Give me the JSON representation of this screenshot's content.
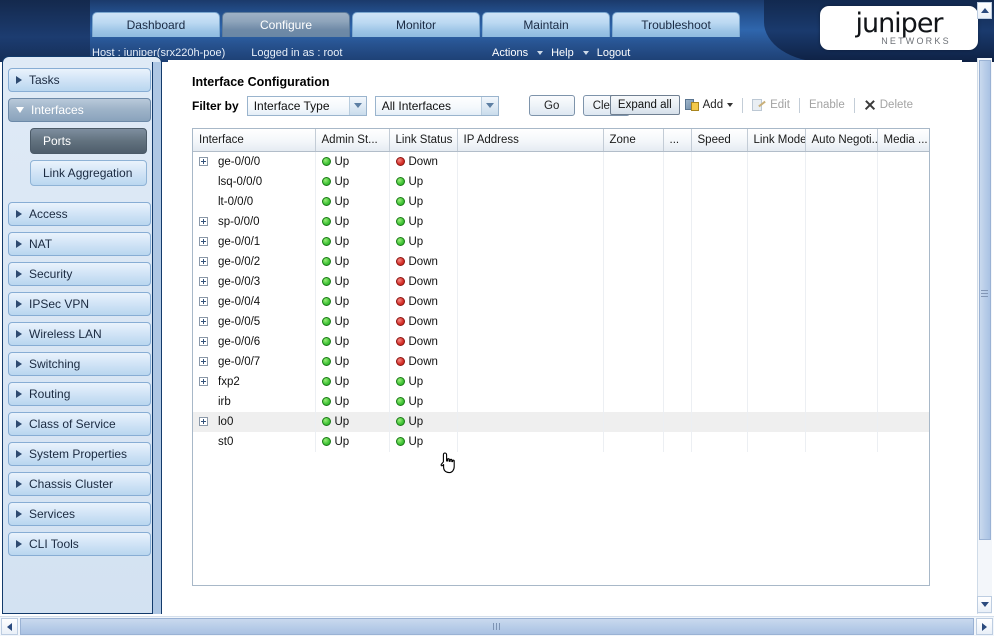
{
  "banner": {
    "tabs": [
      {
        "label": "Dashboard",
        "active": false
      },
      {
        "label": "Configure",
        "active": true
      },
      {
        "label": "Monitor",
        "active": false
      },
      {
        "label": "Maintain",
        "active": false
      },
      {
        "label": "Troubleshoot",
        "active": false
      }
    ],
    "host": "Host : juniper(srx220h-poe)",
    "logged_in": "Logged in as : root",
    "menus": [
      {
        "label": "Actions",
        "has_caret": true
      },
      {
        "label": "Help",
        "has_caret": true
      },
      {
        "label": "Logout",
        "has_caret": false
      }
    ],
    "logo": {
      "word": "juniper",
      "sub": "NETWORKS"
    }
  },
  "sidebar": {
    "items": [
      {
        "label": "Tasks",
        "state": "collapsed"
      },
      {
        "label": "Interfaces",
        "state": "expanded",
        "children": [
          {
            "label": "Ports",
            "selected": true
          },
          {
            "label": "Link Aggregation",
            "selected": false
          }
        ]
      },
      {
        "label": "Access",
        "state": "collapsed"
      },
      {
        "label": "NAT",
        "state": "collapsed"
      },
      {
        "label": "Security",
        "state": "collapsed"
      },
      {
        "label": "IPSec VPN",
        "state": "collapsed"
      },
      {
        "label": "Wireless LAN",
        "state": "collapsed"
      },
      {
        "label": "Switching",
        "state": "collapsed"
      },
      {
        "label": "Routing",
        "state": "collapsed"
      },
      {
        "label": "Class of Service",
        "state": "collapsed"
      },
      {
        "label": "System Properties",
        "state": "collapsed"
      },
      {
        "label": "Chassis Cluster",
        "state": "collapsed"
      },
      {
        "label": "Services",
        "state": "collapsed"
      },
      {
        "label": "CLI Tools",
        "state": "collapsed"
      }
    ]
  },
  "main": {
    "title": "Interface Configuration",
    "filter_label": "Filter by",
    "filter_type_value": "Interface Type",
    "filter_scope_value": "All Interfaces",
    "go_label": "Go",
    "clear_label": "Clear",
    "toolbar": {
      "expand_all": "Expand all",
      "add": "Add",
      "edit": "Edit",
      "enable": "Enable",
      "delete": "Delete"
    },
    "table": {
      "columns": [
        "Interface",
        "Admin St...",
        "Link Status",
        "IP Address",
        "Zone",
        "...",
        "Speed",
        "Link Mode",
        "Auto Negoti...",
        "Media ..."
      ],
      "rows": [
        {
          "expandable": true,
          "interface": "ge-0/0/0",
          "admin": "Up",
          "admin_state": "up",
          "link": "Down",
          "link_state": "down",
          "ip": "",
          "zone": "",
          "extra": "",
          "speed": "",
          "link_mode": "",
          "auto_neg": "",
          "media": "",
          "hover": false
        },
        {
          "expandable": false,
          "interface": "lsq-0/0/0",
          "admin": "Up",
          "admin_state": "up",
          "link": "Up",
          "link_state": "up",
          "ip": "",
          "zone": "",
          "extra": "",
          "speed": "",
          "link_mode": "",
          "auto_neg": "",
          "media": "",
          "hover": false
        },
        {
          "expandable": false,
          "interface": "lt-0/0/0",
          "admin": "Up",
          "admin_state": "up",
          "link": "Up",
          "link_state": "up",
          "ip": "",
          "zone": "",
          "extra": "",
          "speed": "",
          "link_mode": "",
          "auto_neg": "",
          "media": "",
          "hover": false
        },
        {
          "expandable": true,
          "interface": "sp-0/0/0",
          "admin": "Up",
          "admin_state": "up",
          "link": "Up",
          "link_state": "up",
          "ip": "",
          "zone": "",
          "extra": "",
          "speed": "",
          "link_mode": "",
          "auto_neg": "",
          "media": "",
          "hover": false
        },
        {
          "expandable": true,
          "interface": "ge-0/0/1",
          "admin": "Up",
          "admin_state": "up",
          "link": "Up",
          "link_state": "up",
          "ip": "",
          "zone": "",
          "extra": "",
          "speed": "",
          "link_mode": "",
          "auto_neg": "",
          "media": "",
          "hover": false
        },
        {
          "expandable": true,
          "interface": "ge-0/0/2",
          "admin": "Up",
          "admin_state": "up",
          "link": "Down",
          "link_state": "down",
          "ip": "",
          "zone": "",
          "extra": "",
          "speed": "",
          "link_mode": "",
          "auto_neg": "",
          "media": "",
          "hover": false
        },
        {
          "expandable": true,
          "interface": "ge-0/0/3",
          "admin": "Up",
          "admin_state": "up",
          "link": "Down",
          "link_state": "down",
          "ip": "",
          "zone": "",
          "extra": "",
          "speed": "",
          "link_mode": "",
          "auto_neg": "",
          "media": "",
          "hover": false
        },
        {
          "expandable": true,
          "interface": "ge-0/0/4",
          "admin": "Up",
          "admin_state": "up",
          "link": "Down",
          "link_state": "down",
          "ip": "",
          "zone": "",
          "extra": "",
          "speed": "",
          "link_mode": "",
          "auto_neg": "",
          "media": "",
          "hover": false
        },
        {
          "expandable": true,
          "interface": "ge-0/0/5",
          "admin": "Up",
          "admin_state": "up",
          "link": "Down",
          "link_state": "down",
          "ip": "",
          "zone": "",
          "extra": "",
          "speed": "",
          "link_mode": "",
          "auto_neg": "",
          "media": "",
          "hover": false
        },
        {
          "expandable": true,
          "interface": "ge-0/0/6",
          "admin": "Up",
          "admin_state": "up",
          "link": "Down",
          "link_state": "down",
          "ip": "",
          "zone": "",
          "extra": "",
          "speed": "",
          "link_mode": "",
          "auto_neg": "",
          "media": "",
          "hover": false
        },
        {
          "expandable": true,
          "interface": "ge-0/0/7",
          "admin": "Up",
          "admin_state": "up",
          "link": "Down",
          "link_state": "down",
          "ip": "",
          "zone": "",
          "extra": "",
          "speed": "",
          "link_mode": "",
          "auto_neg": "",
          "media": "",
          "hover": false
        },
        {
          "expandable": true,
          "interface": "fxp2",
          "admin": "Up",
          "admin_state": "up",
          "link": "Up",
          "link_state": "up",
          "ip": "",
          "zone": "",
          "extra": "",
          "speed": "",
          "link_mode": "",
          "auto_neg": "",
          "media": "",
          "hover": false
        },
        {
          "expandable": false,
          "interface": "irb",
          "admin": "Up",
          "admin_state": "up",
          "link": "Up",
          "link_state": "up",
          "ip": "",
          "zone": "",
          "extra": "",
          "speed": "",
          "link_mode": "",
          "auto_neg": "",
          "media": "",
          "hover": false
        },
        {
          "expandable": true,
          "interface": "lo0",
          "admin": "Up",
          "admin_state": "up",
          "link": "Up",
          "link_state": "up",
          "ip": "",
          "zone": "",
          "extra": "",
          "speed": "",
          "link_mode": "",
          "auto_neg": "",
          "media": "",
          "hover": true
        },
        {
          "expandable": false,
          "interface": "st0",
          "admin": "Up",
          "admin_state": "up",
          "link": "Up",
          "link_state": "up",
          "ip": "",
          "zone": "",
          "extra": "",
          "speed": "",
          "link_mode": "",
          "auto_neg": "",
          "media": "",
          "hover": false
        }
      ]
    }
  },
  "colors": {
    "status_up": "#35b52b",
    "status_down": "#d8322c",
    "banner_blue": "#2f66ad",
    "accent": "#1b3a6b"
  }
}
